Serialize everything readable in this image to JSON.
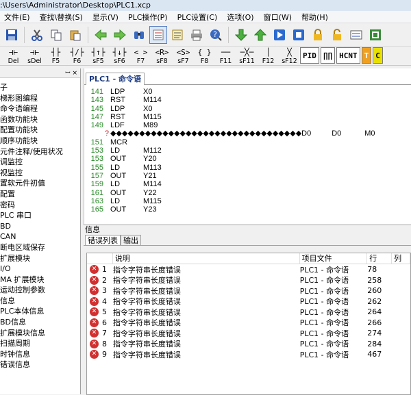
{
  "window": {
    "title": ":\\Users\\Administrator\\Desktop\\PLC1.xcp"
  },
  "menu": [
    "文件(E)",
    "查找\\替换(S)",
    "显示(V)",
    "PLC操作(P)",
    "PLC设置(C)",
    "选项(O)",
    "窗口(W)",
    "帮助(H)"
  ],
  "toolbar_icons": [
    "save-icon",
    "cut-icon",
    "copy-icon",
    "paste-icon",
    "back-arrow-icon",
    "forward-arrow-icon",
    "find-icon",
    "ladder-view-icon",
    "list-view-icon",
    "print-icon",
    "help-icon",
    "download-icon",
    "upload-icon",
    "run-icon",
    "stop-icon",
    "lock-icon",
    "unlock-icon",
    "monitor-icon",
    "settings-icon"
  ],
  "ladder_buttons": [
    {
      "sym": "⊣⊢",
      "key": "Del"
    },
    {
      "sym": "⊣⊢",
      "key": "sDel"
    },
    {
      "sym": "┤├",
      "key": "F5"
    },
    {
      "sym": "┤/├",
      "key": "F6"
    },
    {
      "sym": "┤↑├",
      "key": "sF5"
    },
    {
      "sym": "┤↓├",
      "key": "sF6"
    },
    {
      "sym": "< >",
      "key": "F7"
    },
    {
      "sym": "<R>",
      "key": "sF8"
    },
    {
      "sym": "<S>",
      "key": "sF7"
    },
    {
      "sym": "{ }",
      "key": "F8"
    },
    {
      "sym": "──",
      "key": "F11"
    },
    {
      "sym": "─╳─",
      "key": "sF11"
    },
    {
      "sym": "│",
      "key": "F12"
    },
    {
      "sym": "╳",
      "key": "sF12"
    }
  ],
  "big_buttons": [
    "PID",
    "∏∏",
    "HCNT",
    "T",
    "C"
  ],
  "sidebar": {
    "header": "ꟷ ×",
    "items": [
      "子",
      "梯形图编程",
      "命令语编程",
      "函数功能块",
      "配置功能块",
      "顺序功能块",
      "元件注释/使用状况",
      "调监控",
      "视监控",
      "置软元件初值",
      "配置",
      "密码",
      "PLC 串口",
      "BD",
      "CAN",
      "断电区域保存",
      "扩展模块",
      "I/O",
      "MA 扩展模块",
      "运动控制参数",
      "信息",
      "PLC本体信息",
      "BD信息",
      "扩展模块信息",
      "扫描周期",
      "时钟信息",
      "错误信息"
    ]
  },
  "editor": {
    "tab": "PLC1 - 命令语",
    "lines": [
      {
        "n": "141",
        "op": "LDP",
        "a": "X0",
        "b": "",
        "c": ""
      },
      {
        "n": "143",
        "op": "RST",
        "a": "M114",
        "b": "",
        "c": ""
      },
      {
        "n": "145",
        "op": "LDP",
        "a": "X0",
        "b": "",
        "c": ""
      },
      {
        "n": "147",
        "op": "RST",
        "a": "M115",
        "b": "",
        "c": ""
      },
      {
        "n": "149",
        "op": "LDF",
        "a": "M89",
        "b": "",
        "c": ""
      },
      {
        "n": "",
        "mark": "?",
        "op": "◆◆◆◆◆◆◆◆◆◆◆◆◆◆◆◆◆◆◆◆◆◆◆◆◆◆◆◆◆◆◆◆◆D0",
        "a": "D0",
        "b": "M0",
        "c": ""
      },
      {
        "n": "151",
        "op": "MCR",
        "a": "",
        "b": "",
        "c": ""
      },
      {
        "n": "153",
        "op": "LD",
        "a": "M112",
        "b": "",
        "c": ""
      },
      {
        "n": "153",
        "op": "OUT",
        "a": "Y20",
        "b": "",
        "c": ""
      },
      {
        "n": "155",
        "op": "LD",
        "a": "M113",
        "b": "",
        "c": ""
      },
      {
        "n": "157",
        "op": "OUT",
        "a": "Y21",
        "b": "",
        "c": ""
      },
      {
        "n": "159",
        "op": "LD",
        "a": "M114",
        "b": "",
        "c": ""
      },
      {
        "n": "161",
        "op": "OUT",
        "a": "Y22",
        "b": "",
        "c": ""
      },
      {
        "n": "163",
        "op": "LD",
        "a": "M115",
        "b": "",
        "c": ""
      },
      {
        "n": "165",
        "op": "OUT",
        "a": "Y23",
        "b": "",
        "c": ""
      }
    ]
  },
  "info": {
    "title": "信息",
    "tabs": [
      "错误列表",
      "输出"
    ],
    "columns": [
      "说明",
      "项目文件",
      "行",
      "列"
    ],
    "errors": [
      {
        "no": "1",
        "desc": "指令字符串长度错误",
        "file": "PLC1 - 命令语",
        "line": "78",
        "col": ""
      },
      {
        "no": "2",
        "desc": "指令字符串长度错误",
        "file": "PLC1 - 命令语",
        "line": "258",
        "col": ""
      },
      {
        "no": "3",
        "desc": "指令字符串长度错误",
        "file": "PLC1 - 命令语",
        "line": "260",
        "col": ""
      },
      {
        "no": "4",
        "desc": "指令字符串长度错误",
        "file": "PLC1 - 命令语",
        "line": "262",
        "col": ""
      },
      {
        "no": "5",
        "desc": "指令字符串长度错误",
        "file": "PLC1 - 命令语",
        "line": "264",
        "col": ""
      },
      {
        "no": "6",
        "desc": "指令字符串长度错误",
        "file": "PLC1 - 命令语",
        "line": "266",
        "col": ""
      },
      {
        "no": "7",
        "desc": "指令字符串长度错误",
        "file": "PLC1 - 命令语",
        "line": "274",
        "col": ""
      },
      {
        "no": "8",
        "desc": "指令字符串长度错误",
        "file": "PLC1 - 命令语",
        "line": "284",
        "col": ""
      },
      {
        "no": "9",
        "desc": "指令字符串长度错误",
        "file": "PLC1 - 命令语",
        "line": "467",
        "col": ""
      }
    ]
  },
  "colors": {
    "line_number": "#2a8a2a",
    "error_icon": "#d23030",
    "tab_text": "#1a3a80"
  }
}
